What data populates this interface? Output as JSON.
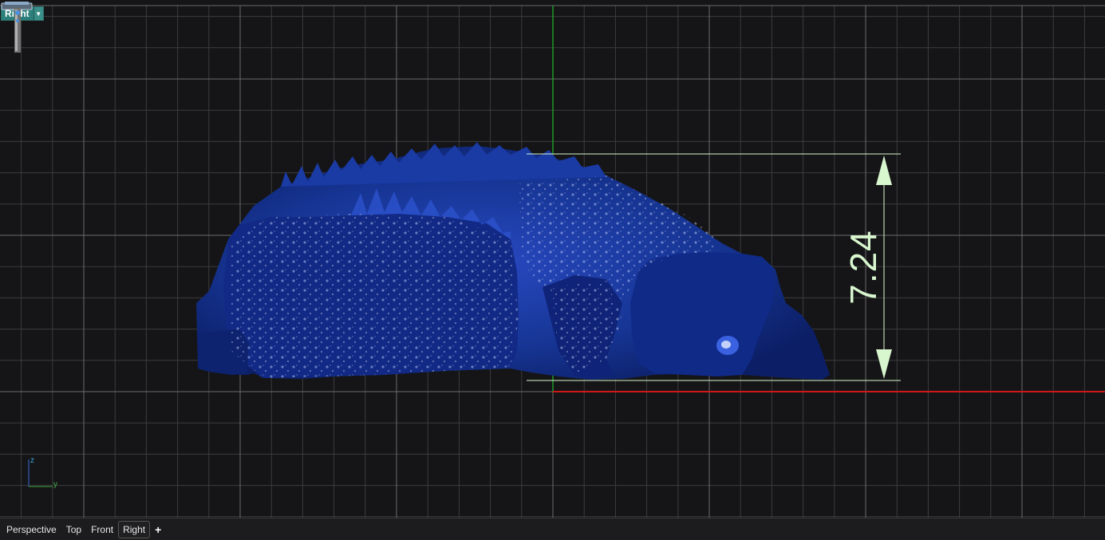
{
  "viewport": {
    "name": "Right",
    "dropdown_icon": "chevron-down-icon",
    "background": "#151517",
    "grid_minor_color": "#3c3c3e",
    "grid_major_color": "#6c6c6e",
    "x_axis_color": "#d01818",
    "y_axis_color": "#1f9a2a"
  },
  "dimension": {
    "value": "7.24",
    "color": "#d8f7cf"
  },
  "model": {
    "name": "crocodile-mesh",
    "color": "#132c8c"
  },
  "axis_indicator": {
    "z": "z",
    "y": "y"
  },
  "tabs": [
    {
      "label": "Perspective",
      "active": false
    },
    {
      "label": "Top",
      "active": false
    },
    {
      "label": "Front",
      "active": false
    },
    {
      "label": "Right",
      "active": true
    }
  ],
  "add_tab_icon": "plus-icon"
}
